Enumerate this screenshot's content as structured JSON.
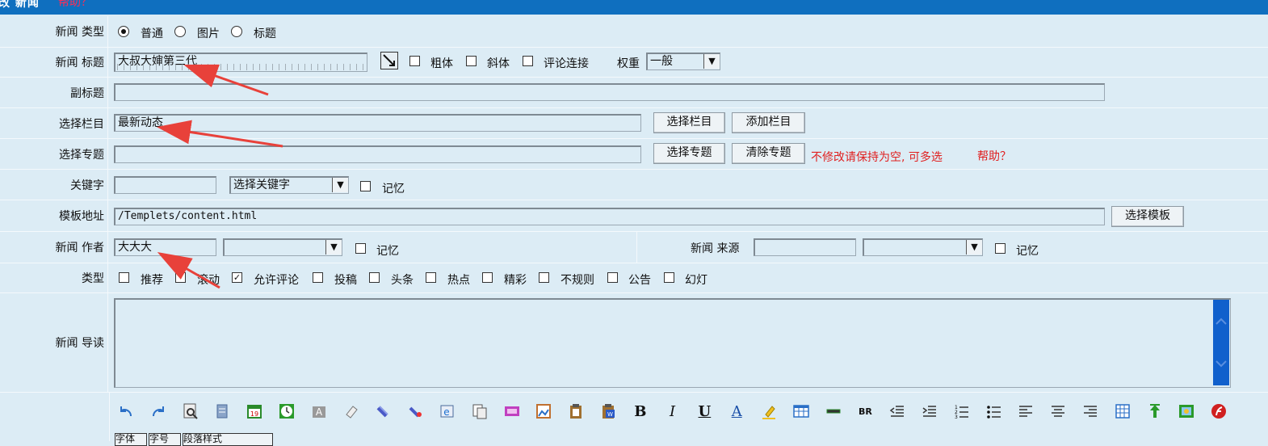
{
  "header": {
    "title": "改 新闻",
    "help": "帮助？"
  },
  "type_row": {
    "label": "新闻 类型",
    "options": [
      "普通",
      "图片",
      "标题"
    ],
    "selected": "普通"
  },
  "title_row": {
    "label": "新闻 标题",
    "value": "大叔大婶第三代",
    "bold": "粗体",
    "italic": "斜体",
    "comment_link": "评论连接",
    "weight_label": "权重",
    "weight_value": "一般"
  },
  "subtitle_row": {
    "label": "副标题",
    "value": ""
  },
  "column_row": {
    "label": "选择栏目",
    "value": "最新动态",
    "select_btn": "选择栏目",
    "add_btn": "添加栏目"
  },
  "topic_row": {
    "label": "选择专题",
    "value": "",
    "select_btn": "选择专题",
    "clear_btn": "清除专题",
    "hint": "不修改请保持为空, 可多选",
    "help": "帮助？"
  },
  "keyword_row": {
    "label": "关键字",
    "value": "",
    "select": "选择关键字",
    "remember": "记忆"
  },
  "template_row": {
    "label": "模板地址",
    "value": "/Templets/content.html",
    "btn": "选择模板"
  },
  "author_row": {
    "label": "新闻 作者",
    "value": "大大大",
    "remember": "记忆",
    "source_label": "新闻 来源",
    "source_value": "",
    "source_remember": "记忆"
  },
  "flags_row": {
    "label": "类型",
    "items": [
      {
        "label": "推荐",
        "checked": false
      },
      {
        "label": "滚动",
        "checked": false
      },
      {
        "label": "允许评论",
        "checked": true
      },
      {
        "label": "投稿",
        "checked": false
      },
      {
        "label": "头条",
        "checked": false
      },
      {
        "label": "热点",
        "checked": false
      },
      {
        "label": "精彩",
        "checked": false
      },
      {
        "label": "不规则",
        "checked": false
      },
      {
        "label": "公告",
        "checked": false
      },
      {
        "label": "幻灯",
        "checked": false
      }
    ]
  },
  "lead_row": {
    "label": "新闻 导读",
    "value": ""
  },
  "editor": {
    "tools": [
      "undo-icon",
      "redo-icon",
      "find-icon",
      "clipboard-icon",
      "calendar-icon",
      "clock-icon",
      "format-icon",
      "eraser-icon",
      "link-icon",
      "unlink-icon",
      "web-icon",
      "copy-icon",
      "media-icon",
      "image-icon",
      "paste-icon",
      "paste-word-icon",
      "bold-icon",
      "italic-icon",
      "underline-icon",
      "font-color-icon",
      "highlight-icon",
      "table-icon",
      "hr-icon",
      "br-icon",
      "outdent-icon",
      "indent-icon",
      "ordered-list-icon",
      "unordered-list-icon",
      "align-left-icon",
      "align-center-icon",
      "align-right-icon",
      "grid-icon",
      "upload-icon",
      "picture-icon",
      "flash-icon"
    ],
    "bold_glyph": "B",
    "italic_glyph": "I",
    "underline_glyph": "U",
    "font_glyph": "A",
    "br_glyph": "BR",
    "calendar_day": "19",
    "bottom_items": [
      "字体",
      "字号",
      "段落样式"
    ]
  }
}
